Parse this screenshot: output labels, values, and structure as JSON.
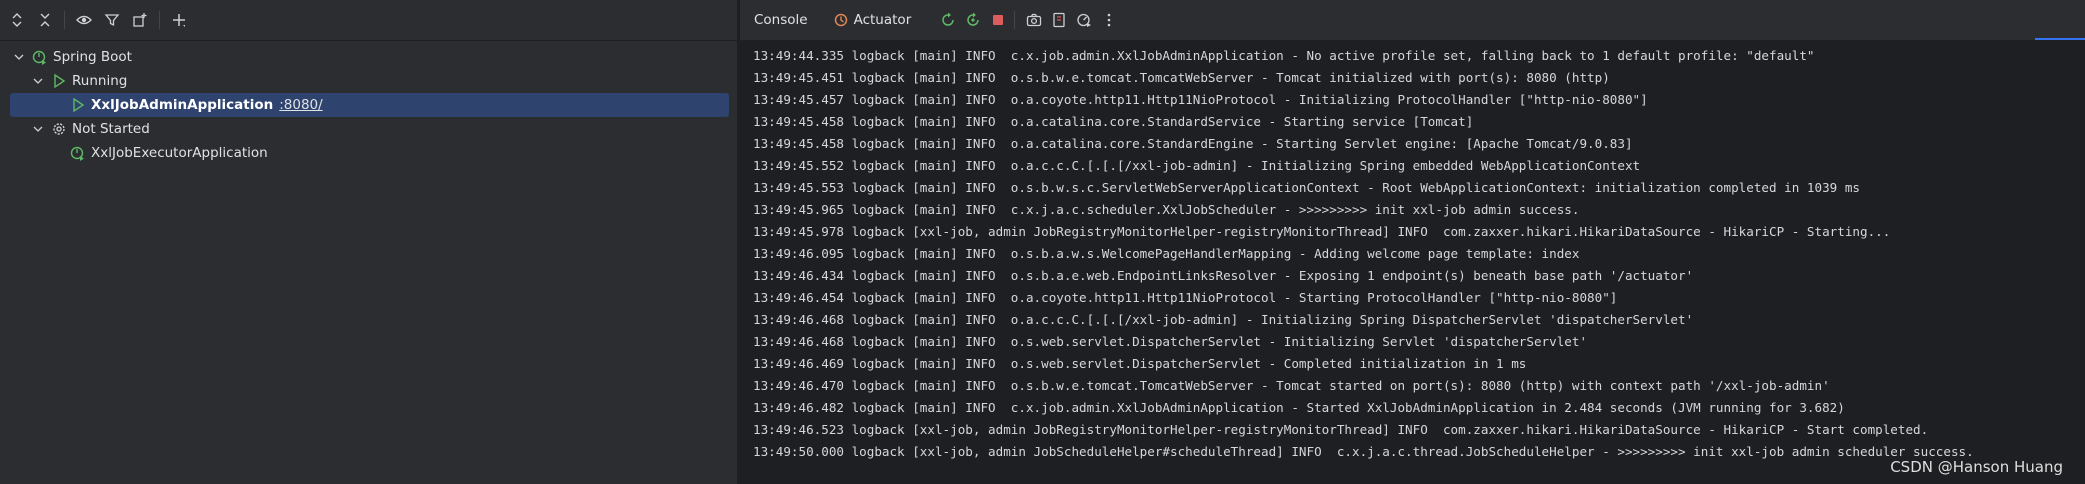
{
  "services": {
    "tree": {
      "root_label": "Spring Boot",
      "running_label": "Running",
      "running_app": "XxlJobAdminApplication",
      "running_port": ":8080/",
      "not_started_label": "Not Started",
      "stopped_app": "XxlJobExecutorApplication"
    }
  },
  "console_panel": {
    "tabs": {
      "console": "Console",
      "actuator": "Actuator"
    },
    "lines": [
      "13:49:44.335 logback [main] INFO  c.x.job.admin.XxlJobAdminApplication - No active profile set, falling back to 1 default profile: \"default\"",
      "13:49:45.451 logback [main] INFO  o.s.b.w.e.tomcat.TomcatWebServer - Tomcat initialized with port(s): 8080 (http)",
      "13:49:45.457 logback [main] INFO  o.a.coyote.http11.Http11NioProtocol - Initializing ProtocolHandler [\"http-nio-8080\"]",
      "13:49:45.458 logback [main] INFO  o.a.catalina.core.StandardService - Starting service [Tomcat]",
      "13:49:45.458 logback [main] INFO  o.a.catalina.core.StandardEngine - Starting Servlet engine: [Apache Tomcat/9.0.83]",
      "13:49:45.552 logback [main] INFO  o.a.c.c.C.[.[.[/xxl-job-admin] - Initializing Spring embedded WebApplicationContext",
      "13:49:45.553 logback [main] INFO  o.s.b.w.s.c.ServletWebServerApplicationContext - Root WebApplicationContext: initialization completed in 1039 ms",
      "13:49:45.965 logback [main] INFO  c.x.j.a.c.scheduler.XxlJobScheduler - >>>>>>>>> init xxl-job admin success.",
      "13:49:45.978 logback [xxl-job, admin JobRegistryMonitorHelper-registryMonitorThread] INFO  com.zaxxer.hikari.HikariDataSource - HikariCP - Starting...",
      "13:49:46.095 logback [main] INFO  o.s.b.a.w.s.WelcomePageHandlerMapping - Adding welcome page template: index",
      "13:49:46.434 logback [main] INFO  o.s.b.a.e.web.EndpointLinksResolver - Exposing 1 endpoint(s) beneath base path '/actuator'",
      "13:49:46.454 logback [main] INFO  o.a.coyote.http11.Http11NioProtocol - Starting ProtocolHandler [\"http-nio-8080\"]",
      "13:49:46.468 logback [main] INFO  o.a.c.c.C.[.[.[/xxl-job-admin] - Initializing Spring DispatcherServlet 'dispatcherServlet'",
      "13:49:46.468 logback [main] INFO  o.s.web.servlet.DispatcherServlet - Initializing Servlet 'dispatcherServlet'",
      "13:49:46.469 logback [main] INFO  o.s.web.servlet.DispatcherServlet - Completed initialization in 1 ms",
      "13:49:46.470 logback [main] INFO  o.s.b.w.e.tomcat.TomcatWebServer - Tomcat started on port(s): 8080 (http) with context path '/xxl-job-admin'",
      "13:49:46.482 logback [main] INFO  c.x.job.admin.XxlJobAdminApplication - Started XxlJobAdminApplication in 2.484 seconds (JVM running for 3.682)",
      "13:49:46.523 logback [xxl-job, admin JobRegistryMonitorHelper-registryMonitorThread] INFO  com.zaxxer.hikari.HikariDataSource - HikariCP - Start completed.",
      "13:49:50.000 logback [xxl-job, admin JobScheduleHelper#scheduleThread] INFO  c.x.j.a.c.thread.JobScheduleHelper - >>>>>>>>> init xxl-job admin scheduler success."
    ]
  },
  "watermark": "CSDN @Hanson Huang",
  "colors": {
    "selection": "#2e436e",
    "run_green": "#5fb865",
    "stop_red": "#db5c5c",
    "actuator_orange": "#e08855",
    "accent_blue": "#3574f0"
  }
}
